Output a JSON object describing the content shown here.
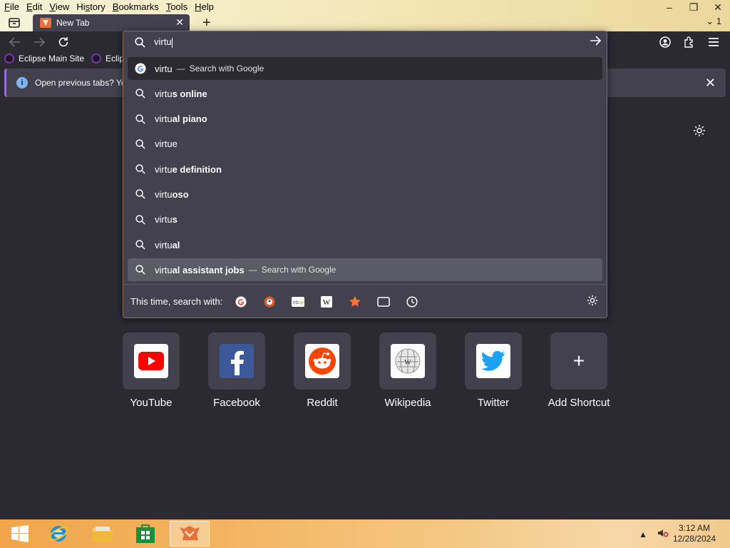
{
  "menu": [
    "File",
    "Edit",
    "View",
    "History",
    "Bookmarks",
    "Tools",
    "Help"
  ],
  "menu_access_keys": [
    "F",
    "E",
    "V",
    "H",
    "B",
    "T",
    "H"
  ],
  "tab": {
    "title": "New Tab",
    "count": "1"
  },
  "bookmarks": [
    "Eclipse Main Site",
    "Eclips"
  ],
  "notification": {
    "text": "Open previous tabs? You"
  },
  "urlbar": {
    "value": "virtu"
  },
  "results": [
    {
      "typed": "virtu",
      "rest": "",
      "action": "Search with Google",
      "icon": "google"
    },
    {
      "typed": "virtu",
      "rest": "s online",
      "action": "",
      "icon": "search"
    },
    {
      "typed": "virtu",
      "rest": "al piano",
      "action": "",
      "icon": "search"
    },
    {
      "typed": "virtu",
      "rest": "e",
      "action": "",
      "icon": "search"
    },
    {
      "typed": "virtu",
      "rest": "e definition",
      "action": "",
      "icon": "search"
    },
    {
      "typed": "virtu",
      "rest": "oso",
      "action": "",
      "icon": "search"
    },
    {
      "typed": "virtu",
      "rest": "s",
      "action": "",
      "icon": "search"
    },
    {
      "typed": "virtu",
      "rest": "al",
      "action": "",
      "icon": "search"
    },
    {
      "typed": "virtu",
      "rest": "al assistant jobs",
      "action": "Search with Google",
      "icon": "search"
    }
  ],
  "oneoff": {
    "label": "This time, search with:"
  },
  "shortcuts": [
    "YouTube",
    "Facebook",
    "Reddit",
    "Wikipedia",
    "Twitter",
    "Add Shortcut"
  ],
  "clock": {
    "time": "3:12 AM",
    "date": "12/28/2024"
  },
  "colors": {
    "page_bg": "#2b2a33",
    "panel": "#42414d",
    "accent_orange": "#e8713a"
  }
}
